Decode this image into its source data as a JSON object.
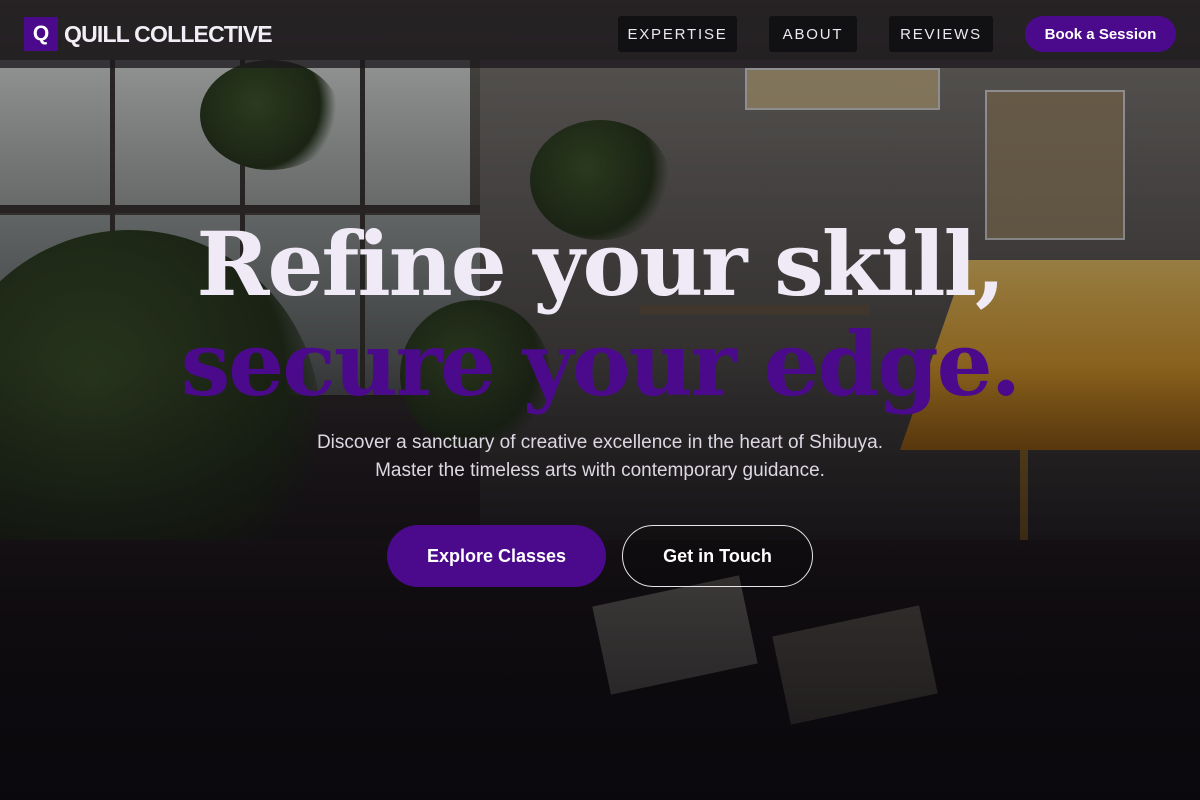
{
  "brand": {
    "mark": "Q",
    "name": "QUILL COLLECTIVE"
  },
  "nav": {
    "links": [
      {
        "label": "EXPERTISE"
      },
      {
        "label": "ABOUT"
      },
      {
        "label": "REVIEWS"
      }
    ],
    "cta_label": "Book a Session"
  },
  "hero": {
    "headline_line1": "Refine your skill,",
    "headline_line2": "secure your edge.",
    "subtitle_line1": "Discover a sanctuary of creative excellence in the heart of Shibuya.",
    "subtitle_line2": "Master the timeless arts with contemporary guidance.",
    "primary_cta": "Explore Classes",
    "secondary_cta": "Get in Touch"
  },
  "colors": {
    "accent": "#4b0a8c",
    "headline": "#efeaf6",
    "nav_bg": "#1c181c"
  }
}
